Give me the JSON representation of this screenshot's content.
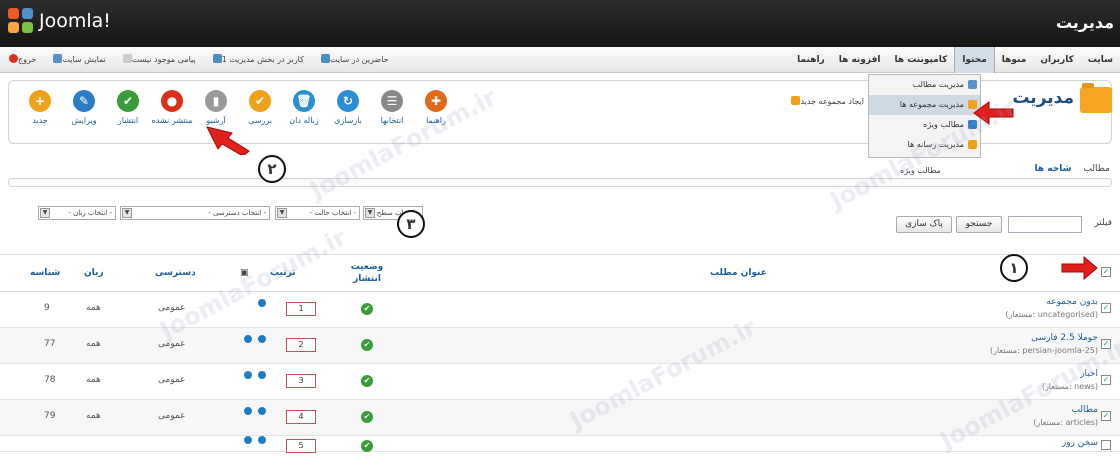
{
  "brand": {
    "name": "Joomla!",
    "title": "مدیریت"
  },
  "menu": {
    "items": [
      "سایت",
      "کاربران",
      "منوها",
      "محتوا",
      "کامپوننت ها",
      "افزونه ها",
      "راهنما"
    ],
    "active_index": 3
  },
  "status": {
    "logout": "خروج",
    "view_site": "نمایش سایت",
    "messages": "پیامی موجود نیست",
    "admins": "1 کاربر در بخش مدیریت",
    "site_users": "حاضرین در سایت"
  },
  "toolbar": [
    {
      "label": "جدید",
      "icon": "+",
      "color": "#f0a21d"
    },
    {
      "label": "ویرایش",
      "icon": "✎",
      "color": "#2c7bc7"
    },
    {
      "label": "انتشار",
      "icon": "✔",
      "color": "#3a9b3a"
    },
    {
      "label": "منتشر نشده",
      "icon": "●",
      "color": "#d9301c"
    },
    {
      "label": "آرشیو",
      "icon": "▮",
      "color": "#999999"
    },
    {
      "label": "بررسی",
      "icon": "✔",
      "color": "#f0a21d"
    },
    {
      "label": "زباله دان",
      "icon": "🗑",
      "color": "#2c8fd6"
    },
    {
      "label": "بازسازی",
      "icon": "↻",
      "color": "#2c8fd6"
    },
    {
      "label": "انتخابها",
      "icon": "☰",
      "color": "#888888"
    },
    {
      "label": "راهنما",
      "icon": "✚",
      "color": "#e06a1a"
    }
  ],
  "dropdown": {
    "items": [
      "مدیریت مطالب",
      "مدیریت مجموعه ها",
      "مطالب ویژه",
      "مدیریت رسانه ها"
    ],
    "active_index": 1
  },
  "page": {
    "title": "مدیریت",
    "new_category": "ایجاد مجموعه جدید"
  },
  "subnav": {
    "items": [
      "مطالب",
      "شاخه ها"
    ],
    "active_index": 1,
    "featured": "مطالب ویژه"
  },
  "filters": {
    "label": "فیلتر",
    "search": "جستجو",
    "clear": "پاک سازی",
    "level": "- انتخاب سطح -",
    "state": "- انتخاب حالت -",
    "access": "- انتخاب دسترسی -",
    "language": "- انتخاب زبان -"
  },
  "table": {
    "headers": {
      "title": "عنوان مطلب",
      "status": "وضعیت انتشار",
      "ordering": "ترتیب",
      "access": "دسترسی",
      "language": "زبان",
      "id": "شناسه"
    },
    "rows": [
      {
        "title": "بدون مجموعه",
        "alias": "(مستعار: uncategorised)",
        "order": "1",
        "access": "عمومی",
        "lang": "همه",
        "id": "9"
      },
      {
        "title": "جوملا 2.5 فارسی",
        "alias": "(مستعار: persian-joomla-25)",
        "order": "2",
        "access": "عمومی",
        "lang": "همه",
        "id": "77"
      },
      {
        "title": "اخبار",
        "alias": "(مستعار: news)",
        "order": "3",
        "access": "عمومی",
        "lang": "همه",
        "id": "78"
      },
      {
        "title": "مطالب",
        "alias": "(مستعار: articles)",
        "order": "4",
        "access": "عمومی",
        "lang": "همه",
        "id": "79"
      },
      {
        "title": "سخن روز",
        "alias": "",
        "order": "5",
        "access": "",
        "lang": "",
        "id": ""
      }
    ]
  },
  "watermark": "JoomlaForum.ir",
  "callouts": [
    "۱",
    "۲",
    "۳"
  ]
}
